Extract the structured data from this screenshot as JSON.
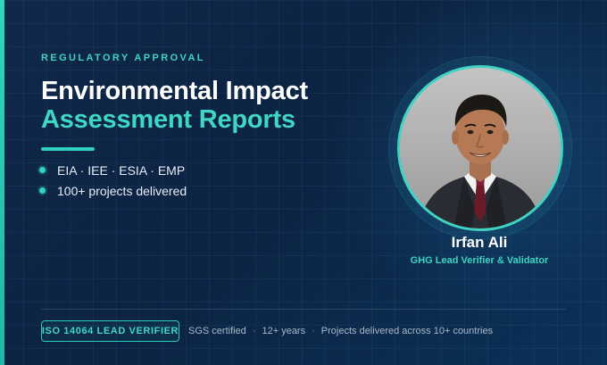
{
  "eyebrow": "REGULATORY APPROVAL",
  "title": {
    "line1": "Environmental Impact",
    "line2": "Assessment Reports"
  },
  "bullets": [
    "EIA · IEE · ESIA · EMP",
    "100+ projects delivered"
  ],
  "person": {
    "name": "Irfan Ali",
    "role": "GHG Lead Verifier & Validator",
    "photo_icon": "portrait-photo"
  },
  "footer": {
    "badge": "ISO 14064 LEAD VERIFIER",
    "meta": [
      "SGS certified",
      "12+ years",
      "Projects delivered across 10+ countries"
    ],
    "separator": "·"
  },
  "colors": {
    "background": "#0c2342",
    "accent": "#3fd3c2",
    "text": "#ffffff"
  }
}
